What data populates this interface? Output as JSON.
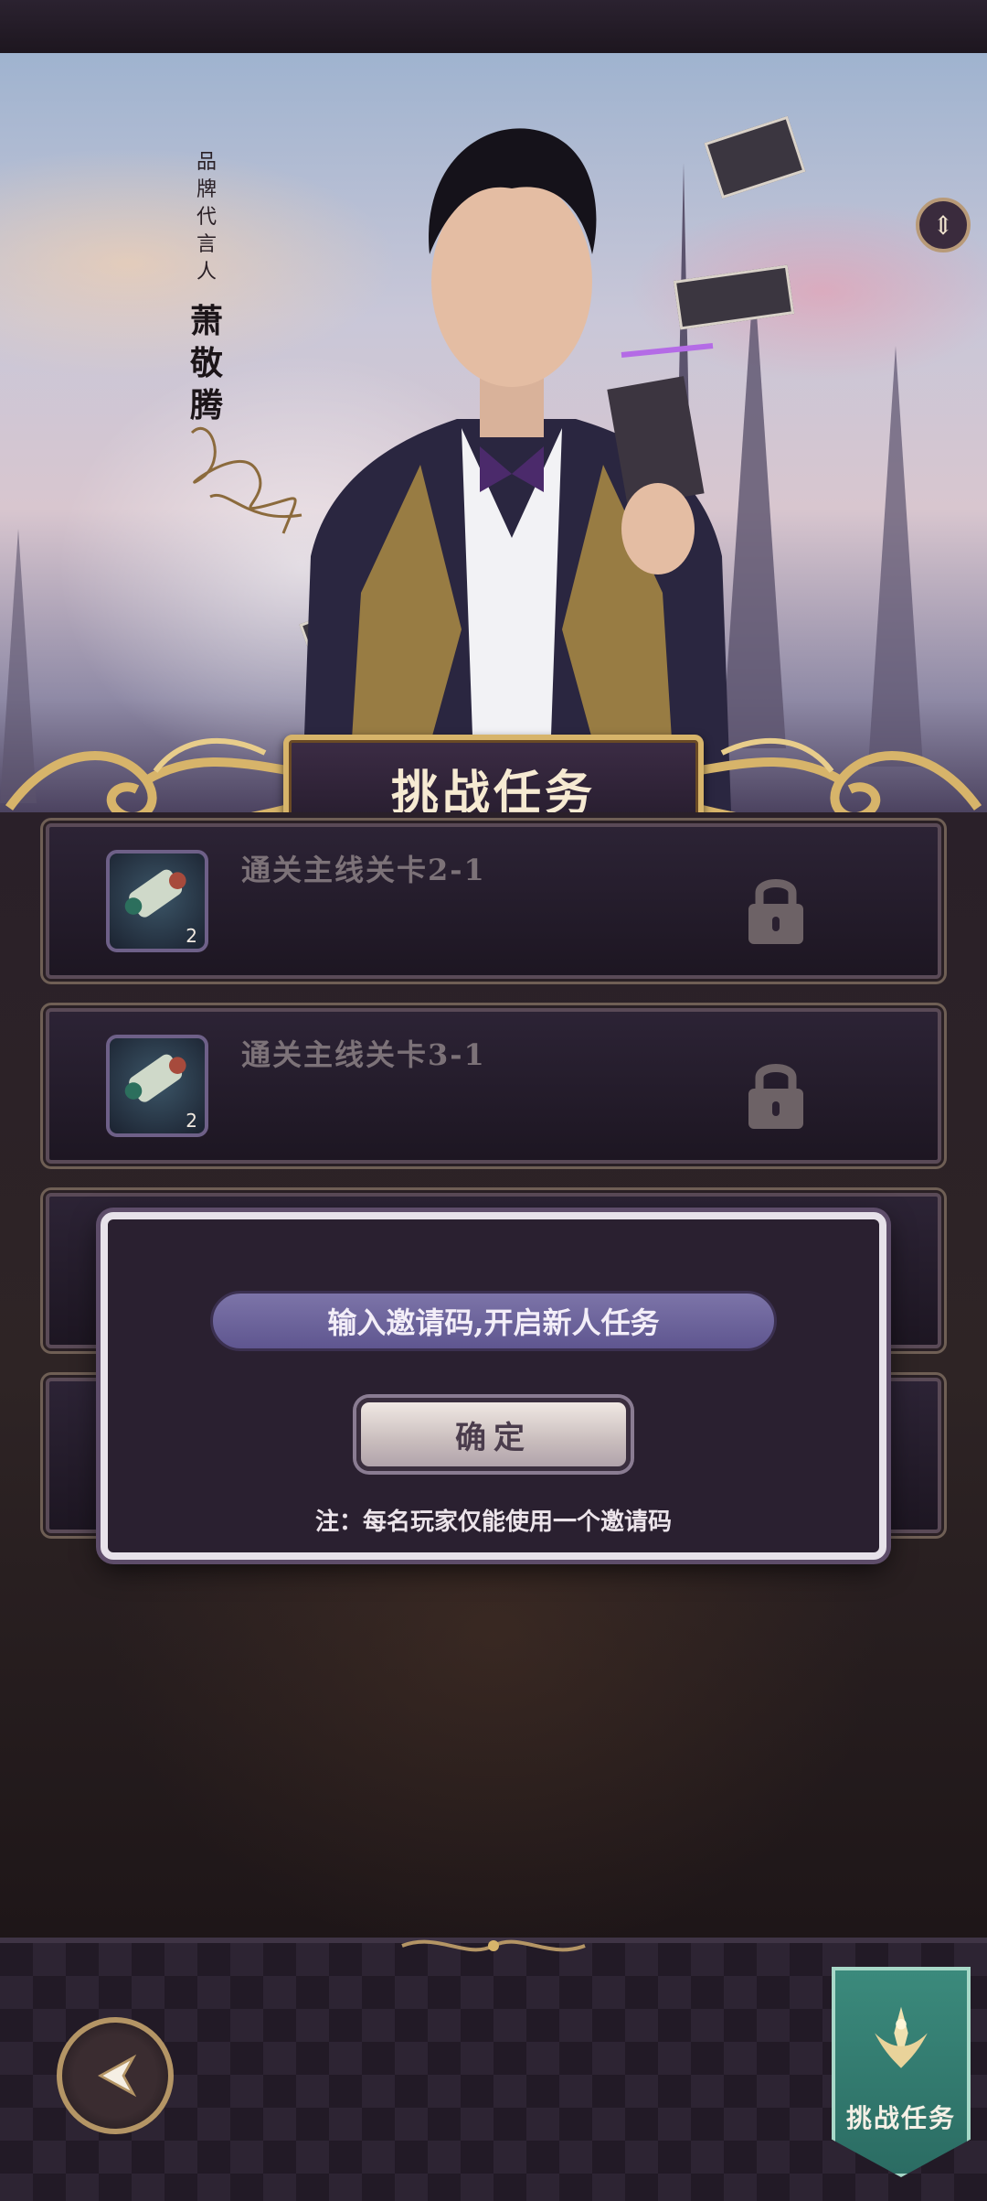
{
  "banner": {
    "endorser_caption": "品牌代言人",
    "endorser_name": "萧敬腾",
    "title": "挑战任务"
  },
  "tasks": [
    {
      "title": "通关主线关卡2-1",
      "count": "2",
      "locked": true
    },
    {
      "title": "通关主线关卡3-1",
      "count": "2",
      "locked": true
    }
  ],
  "dialog": {
    "field_text": "输入邀请码,开启新人任务",
    "confirm_label": "确定",
    "note": "注：每名玩家仅能使用一个邀请码"
  },
  "bottom_nav": {
    "back_icon": "back-arrow-icon",
    "tab_label": "挑战任务",
    "tab_icon": "crest-icon"
  },
  "colors": {
    "accent_gold": "#d7b46a",
    "tab_green": "#3b8a7c",
    "dialog_bg": "#2a2030"
  }
}
